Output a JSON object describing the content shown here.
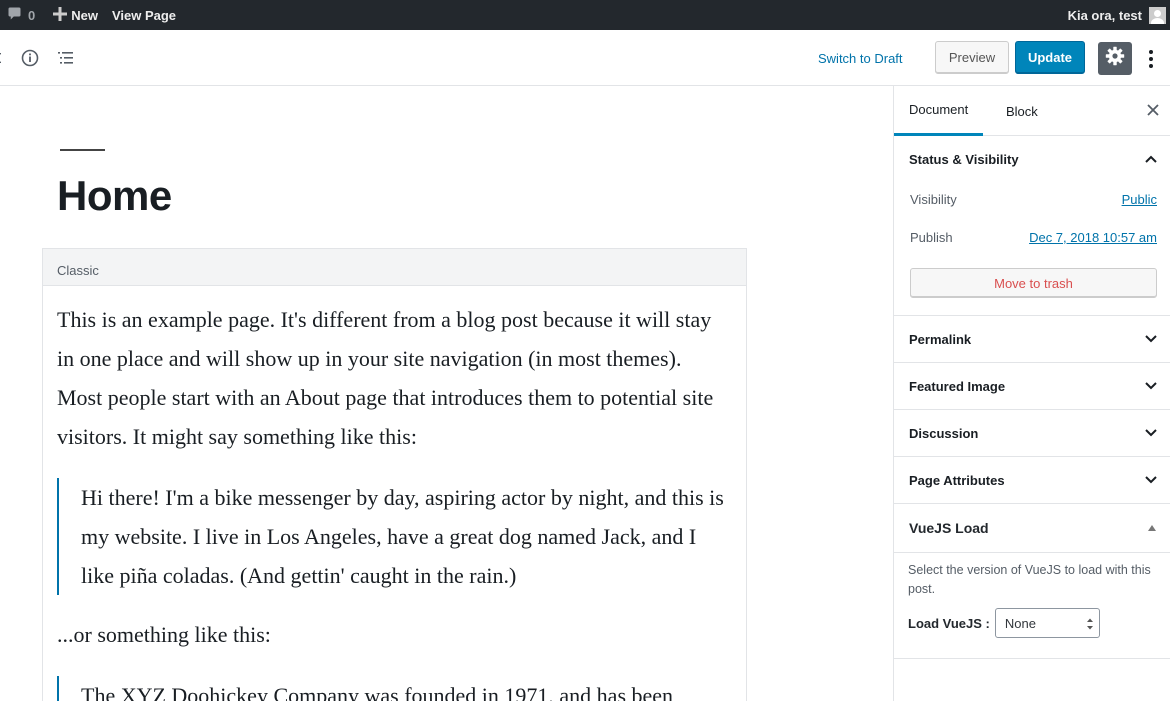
{
  "admin_bar": {
    "comments_count": "0",
    "new_label": "New",
    "view_page_label": "View Page",
    "greeting": "Kia ora, test"
  },
  "header": {
    "switch_to_draft": "Switch to Draft",
    "preview": "Preview",
    "update": "Update",
    "icons": [
      "info-icon",
      "outline-icon",
      "settings-gear-icon",
      "more-menu-icon"
    ]
  },
  "editor": {
    "title": "Home",
    "classic_block_label": "Classic",
    "paragraphs": [
      "This is an example page. It's different from a blog post because it will stay in one place and will show up in your site navigation (in most themes). Most people start with an About page that introduces them to potential site visitors. It might say something like this:",
      "...or something like this:"
    ],
    "quotes": [
      "Hi there! I'm a bike messenger by day, aspiring actor by night, and this is my website. I live in Los Angeles, have a great dog named Jack, and I like piña coladas. (And gettin' caught in the rain.)",
      "The XYZ Doohickey Company was founded in 1971, and has been"
    ]
  },
  "sidebar": {
    "tabs": [
      "Document",
      "Block"
    ],
    "active_tab": "Document",
    "status_visibility": {
      "title": "Status & Visibility",
      "visibility_label": "Visibility",
      "visibility_value": "Public",
      "publish_label": "Publish",
      "publish_value": "Dec 7, 2018 10:57 am",
      "trash": "Move to trash"
    },
    "panels": [
      "Permalink",
      "Featured Image",
      "Discussion",
      "Page Attributes"
    ],
    "vuejs": {
      "title": "VueJS Load",
      "description": "Select the version of VueJS to load with this post.",
      "load_label": "Load VueJS :",
      "selected": "None"
    }
  },
  "colors": {
    "accent": "#0085ba",
    "link": "#0073aa",
    "admin_bar": "#23282d",
    "danger": "#d94f4f"
  }
}
